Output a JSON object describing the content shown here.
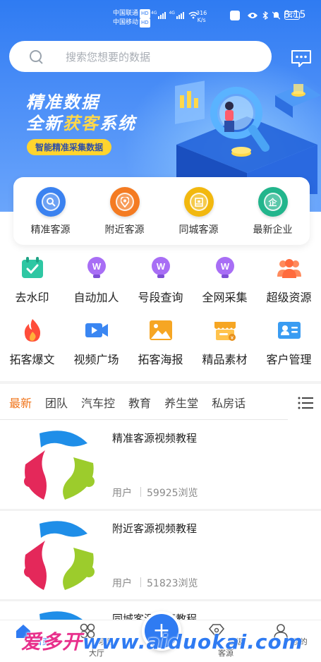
{
  "status_bar": {
    "carrier1": "中国联通",
    "carrier2": "中国移动",
    "hd": "HD",
    "net1": "4G",
    "net2": "4G",
    "speed_value": "316",
    "speed_unit": "K/s",
    "battery": "67",
    "time": "8:15"
  },
  "search": {
    "placeholder": "搜索您想要的数据",
    "icon": "search-icon"
  },
  "header": {
    "message_icon": "chat-bubble-icon"
  },
  "banner": {
    "line1": "精准数据",
    "line2_prefix": "全新",
    "line2_highlight": "获客",
    "line2_suffix": "系统",
    "tag": "智能精准采集数据",
    "colors": {
      "highlight": "#ffd84a",
      "tag_bg": "#ffd42e"
    }
  },
  "quick_actions": [
    {
      "label": "精准客源",
      "icon": "magnifier-icon",
      "color": "#3b82f0"
    },
    {
      "label": "附近客源",
      "icon": "location-pin-icon",
      "color": "#f47b22"
    },
    {
      "label": "同城客源",
      "icon": "building-icon",
      "color": "#f2b80f"
    },
    {
      "label": "最新企业",
      "icon": "enterprise-icon",
      "glyph": "企",
      "color": "#22b58c"
    }
  ],
  "grid": [
    [
      {
        "label": "去水印",
        "icon": "calendar-check-icon"
      },
      {
        "label": "自动加人",
        "icon": "w-bulb-icon"
      },
      {
        "label": "号段查询",
        "icon": "w-bulb-icon"
      },
      {
        "label": "全网采集",
        "icon": "w-bulb-icon"
      },
      {
        "label": "超级资源",
        "icon": "people-icon"
      }
    ],
    [
      {
        "label": "拓客爆文",
        "icon": "flame-icon"
      },
      {
        "label": "视频广场",
        "icon": "video-camera-icon"
      },
      {
        "label": "拓客海报",
        "icon": "image-icon"
      },
      {
        "label": "精品素材",
        "icon": "store-icon"
      },
      {
        "label": "客户管理",
        "icon": "contact-card-icon"
      }
    ]
  ],
  "tabs": {
    "items": [
      "最新",
      "团队",
      "汽车控",
      "教育",
      "养生堂",
      "私房话"
    ],
    "active_index": 0,
    "menu_icon": "list-menu-icon"
  },
  "list": [
    {
      "title": "精准客源视频教程",
      "author": "用户",
      "views": "59925浏览"
    },
    {
      "title": "附近客源视频教程",
      "author": "用户",
      "views": "51823浏览"
    },
    {
      "title": "同城客源视频教程",
      "author": "",
      "views": ""
    }
  ],
  "bottom_nav": {
    "items": [
      {
        "label": "首页",
        "icon": "home-icon"
      },
      {
        "label": "项目大厅",
        "icon": "grid-hall-icon"
      },
      {
        "label": "超级客源",
        "icon": "diamond-icon"
      },
      {
        "label": "我的",
        "icon": "profile-icon"
      }
    ],
    "fab_symbol": "+",
    "accent": "#2f7bf2"
  },
  "watermark": {
    "cn": "爱多开",
    "url": "www.aiduokai.com"
  }
}
